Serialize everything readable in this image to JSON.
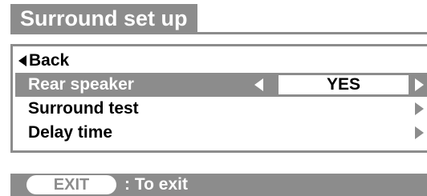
{
  "title": "Surround set up",
  "menu": {
    "back_label": "Back",
    "items": [
      {
        "label": "Rear speaker",
        "value": "YES",
        "selected": true
      },
      {
        "label": "Surround test"
      },
      {
        "label": "Delay time"
      }
    ]
  },
  "footer": {
    "exit_button": "EXIT",
    "exit_text": ": To exit"
  },
  "colors": {
    "panel_gray": "#8c8c8c",
    "text": "#000000",
    "highlight_text": "#ffffff"
  },
  "icons": [
    "left-arrow-icon",
    "right-arrow-icon"
  ]
}
